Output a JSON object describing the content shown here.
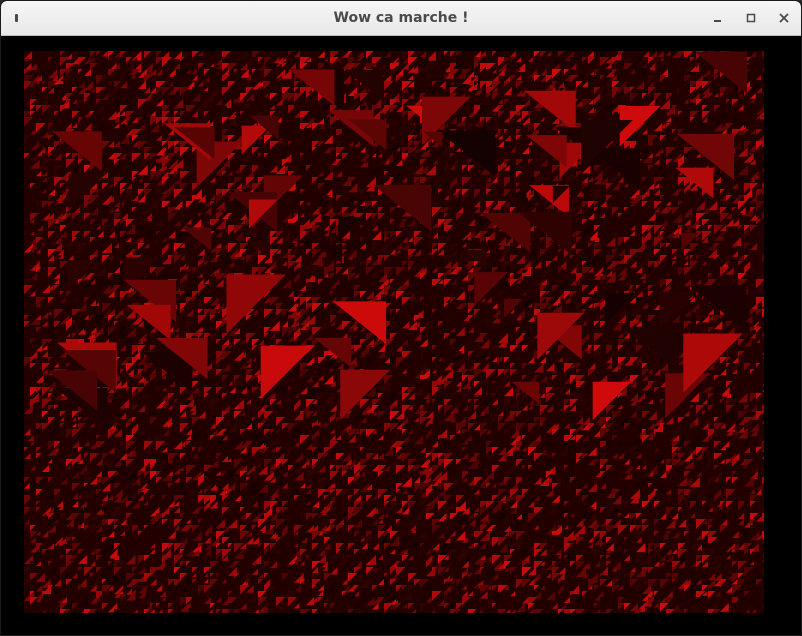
{
  "window": {
    "title": "Wow ca marche !"
  },
  "icons": {
    "menu": "menu-icon",
    "minimize": "minimize-icon",
    "maximize": "maximize-icon",
    "close": "close-icon"
  },
  "colors": {
    "titlebar": "#ececec",
    "title_text": "#4a4a4a",
    "background": "#000000",
    "render_dark": "#1a0000",
    "render_mid": "#6e0303",
    "render_bright": "#c80e0e"
  }
}
